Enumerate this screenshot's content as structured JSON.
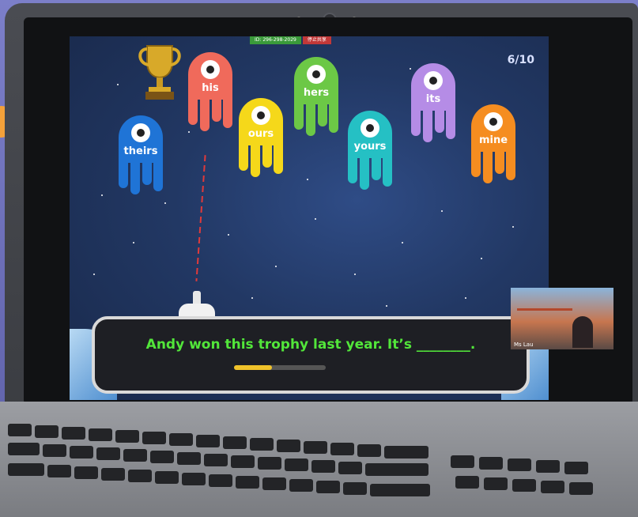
{
  "game": {
    "progress_label": "6/10",
    "topbar": {
      "meeting_id": "ID: 296-298-2029",
      "stop_share": "停止共享"
    },
    "monsters": [
      {
        "word": "his",
        "color": "#f06a5b"
      },
      {
        "word": "hers",
        "color": "#6cc846"
      },
      {
        "word": "its",
        "color": "#b58ce6"
      },
      {
        "word": "theirs",
        "color": "#1f74d6"
      },
      {
        "word": "ours",
        "color": "#f5d81a"
      },
      {
        "word": "yours",
        "color": "#25c0c4"
      },
      {
        "word": "mine",
        "color": "#f58d20"
      }
    ],
    "question": "Andy won this trophy last year. It’s ________.",
    "question_progress": 0.4
  },
  "video_tile": {
    "participant": "Ms Lau"
  },
  "icons": [
    "trophy-icon",
    "cannon-icon",
    "webcam-icon"
  ]
}
